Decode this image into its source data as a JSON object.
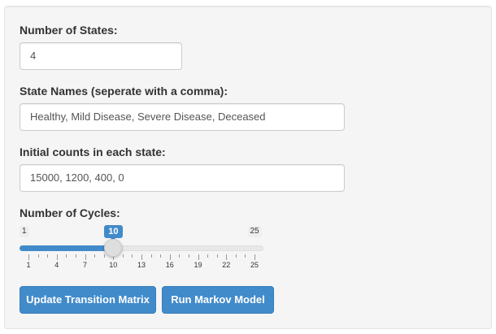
{
  "form": {
    "num_states_label": "Number of States:",
    "num_states_value": "4",
    "state_names_label": "State Names (seperate with a comma):",
    "state_names_value": "Healthy, Mild Disease, Severe Disease, Deceased",
    "initial_counts_label": "Initial counts in each state:",
    "initial_counts_value": "15000, 1200, 400, 0",
    "cycles_label": "Number of Cycles:"
  },
  "slider": {
    "min": 1,
    "max": 25,
    "value": 10,
    "min_label": "1",
    "max_label": "25",
    "value_label": "10",
    "tick_labels": [
      "1",
      "4",
      "7",
      "10",
      "13",
      "16",
      "19",
      "22",
      "25"
    ],
    "accent_color": "#428bca"
  },
  "buttons": {
    "update_label": "Update Transition Matrix",
    "run_label": "Run Markov Model"
  }
}
